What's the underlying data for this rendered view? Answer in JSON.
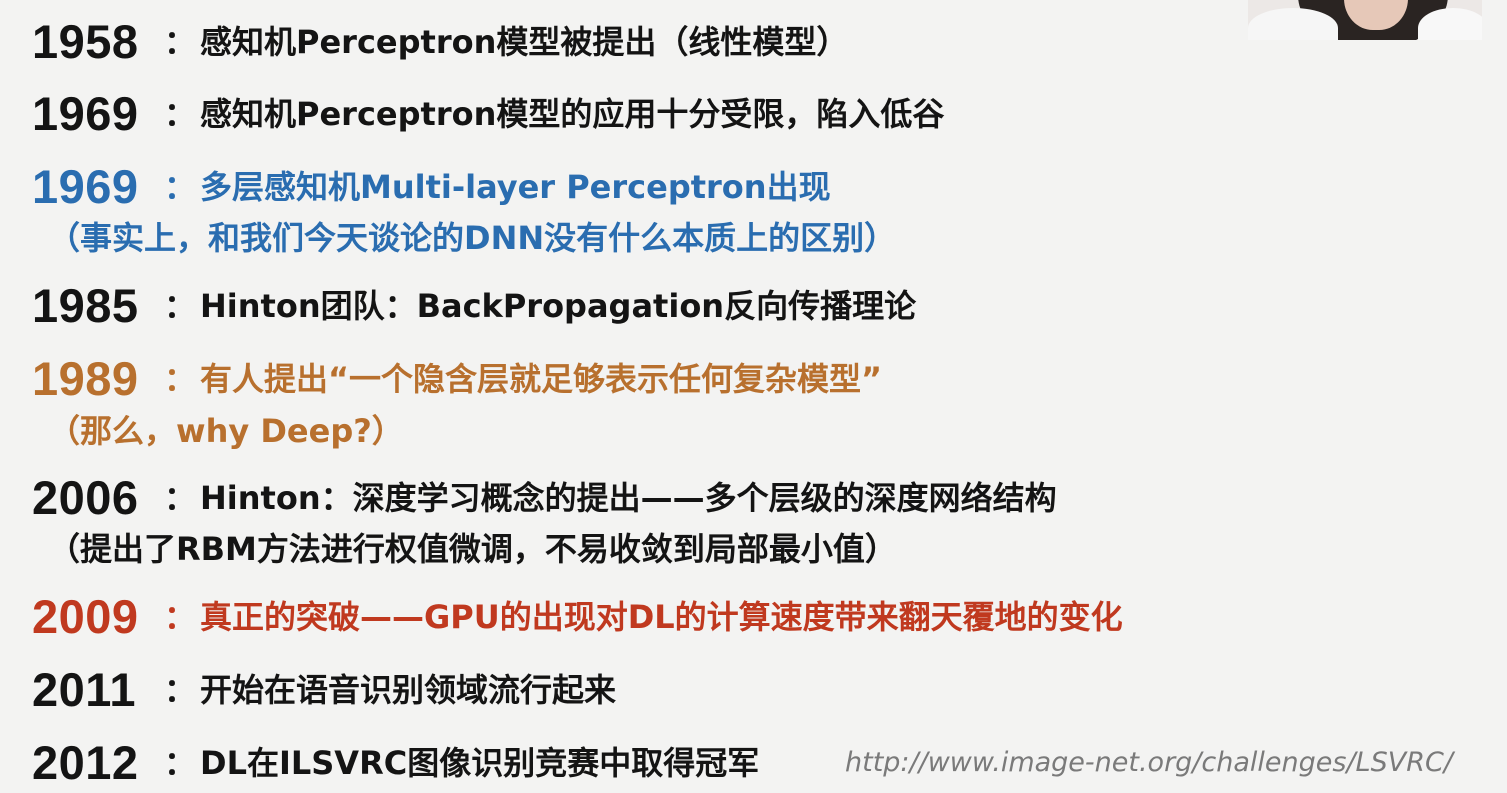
{
  "timeline": [
    {
      "year": "1958",
      "colon": "：",
      "text": "感知机Perceptron模型被提出（线性模型）",
      "color": "#141414"
    },
    {
      "year": "1969",
      "colon": "：",
      "text": "感知机Perceptron模型的应用十分受限，陷入低谷",
      "color": "#141414"
    },
    {
      "year": "1969",
      "colon": "：",
      "text": "多层感知机Multi-layer Perceptron出现",
      "sub": "（事实上，和我们今天谈论的DNN没有什么本质上的区别）",
      "color": "#2a6db0"
    },
    {
      "year": "1985",
      "colon": "：",
      "text": "Hinton团队：BackPropagation反向传播理论",
      "color": "#141414"
    },
    {
      "year": "1989",
      "colon": "：",
      "text": "有人提出“一个隐含层就足够表示任何复杂模型”",
      "sub": "（那么，why Deep?）",
      "color": "#b8702e"
    },
    {
      "year": "2006",
      "colon": "：",
      "text": "Hinton：深度学习概念的提出——多个层级的深度网络结构",
      "sub": "（提出了RBM方法进行权值微调，不易收敛到局部最小值）",
      "color": "#141414"
    },
    {
      "year": "2009",
      "colon": "：",
      "text": "真正的突破——GPU的出现对DL的计算速度带来翻天覆地的变化",
      "color": "#c0391f"
    },
    {
      "year": "2011",
      "colon": "：",
      "text": "开始在语音识别领域流行起来",
      "color": "#141414"
    },
    {
      "year": "2012",
      "colon": "：",
      "text": "DL在ILSVRC图像识别竞赛中取得冠军",
      "color": "#141414"
    }
  ],
  "source_link": "http://www.image-net.org/challenges/LSVRC/"
}
